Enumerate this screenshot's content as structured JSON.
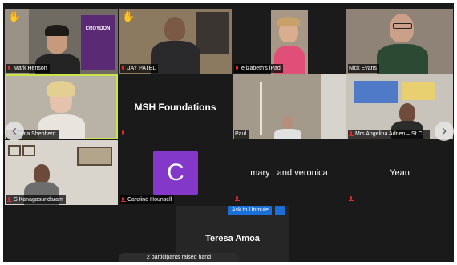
{
  "participants": {
    "p1": {
      "name": "Mark Henson",
      "banner": "CROYDON"
    },
    "p2": {
      "name": "JAY PATEL"
    },
    "p3": {
      "name": "elizabeth's iPad"
    },
    "p4": {
      "name": "Nick Evans"
    },
    "p5": {
      "name": "Emma Shepherd"
    },
    "p6": {
      "name": "MSH Foundations"
    },
    "p7": {
      "name": "Paul"
    },
    "p8": {
      "name": "Mrs Angelina Adrien – St C..."
    },
    "p9": {
      "name": "S Kanagasundaram"
    },
    "p10": {
      "name": "Caroline Hounsell",
      "initial": "C"
    },
    "p11": {
      "name": "mary   and veronica"
    },
    "p12": {
      "name": "Yean"
    },
    "p13": {
      "name": "Teresa Amoa"
    }
  },
  "controls": {
    "unmute": "Ask to Unmute",
    "more": "...",
    "prev": "‹",
    "next": "›"
  },
  "status": {
    "raised_hands": "2 participants raised hand"
  },
  "icons": {
    "hand": "raised-hand-icon",
    "mic": "mic-muted-icon"
  },
  "colors": {
    "active_speaker": "#c9e34a",
    "avatar_bg": "#8338c9",
    "unmute_bg": "#1b6fd8",
    "muted_mic": "#e02b2b"
  }
}
